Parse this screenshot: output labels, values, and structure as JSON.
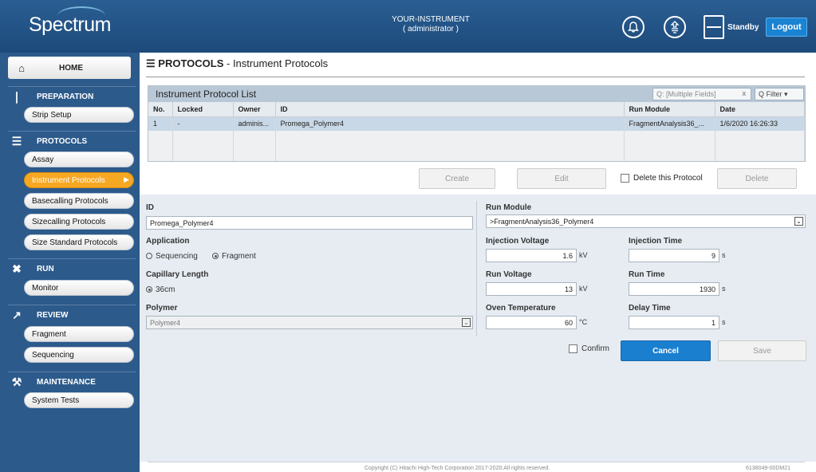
{
  "header": {
    "logo": "Spectrum",
    "instrument": "YOUR-INSTRUMENT",
    "user": "( administrator )",
    "standby": "Standby",
    "logout": "Logout"
  },
  "sidebar": {
    "home": "HOME",
    "preparation": {
      "label": "PREPARATION",
      "items": [
        "Strip Setup"
      ]
    },
    "protocols": {
      "label": "PROTOCOLS",
      "items": [
        "Assay",
        "Instrument Protocols",
        "Basecalling Protocols",
        "Sizecalling Protocols",
        "Size Standard Protocols"
      ]
    },
    "run": {
      "label": "RUN",
      "items": [
        "Monitor"
      ]
    },
    "review": {
      "label": "REVIEW",
      "items": [
        "Fragment",
        "Sequencing"
      ]
    },
    "maintenance": {
      "label": "MAINTENANCE",
      "items": [
        "System Tests"
      ]
    }
  },
  "page": {
    "title": "PROTOCOLS",
    "subtitle": " - Instrument Protocols"
  },
  "list": {
    "title": "Instrument Protocol List",
    "search_placeholder": "Q: [Multiple Fields]",
    "search_clear": "x",
    "filter": "Q  Filter  ▾",
    "columns": [
      "No.",
      "Locked",
      "Owner",
      "ID",
      "Run Module",
      "Date"
    ],
    "rows": [
      [
        "1",
        "-",
        "adminis...",
        "Promega_Polymer4",
        "FragmentAnalysis36_...",
        "1/6/2020 16:26:33"
      ]
    ]
  },
  "actions": {
    "create": "Create",
    "edit": "Edit",
    "delete_check": "Delete this Protocol",
    "delete": "Delete"
  },
  "form": {
    "id_label": "ID",
    "id_value": "Promega_Polymer4",
    "application_label": "Application",
    "app_sequencing": "Sequencing",
    "app_fragment": "Fragment",
    "capillary_label": "Capillary Length",
    "capillary_value": "36cm",
    "polymer_label": "Polymer",
    "polymer_value": "Polymer4",
    "run_module_label": "Run Module",
    "run_module_value": ">FragmentAnalysis36_Polymer4",
    "inj_voltage_label": "Injection Voltage",
    "inj_voltage": "1.6",
    "inj_voltage_unit": "kV",
    "inj_time_label": "Injection Time",
    "inj_time": "9",
    "inj_time_unit": "s",
    "run_voltage_label": "Run Voltage",
    "run_voltage": "13",
    "run_voltage_unit": "kV",
    "run_time_label": "Run Time",
    "run_time": "1930",
    "run_time_unit": "s",
    "oven_label": "Oven Temperature",
    "oven": "60",
    "oven_unit": "°C",
    "delay_label": "Delay Time",
    "delay": "1",
    "delay_unit": "s",
    "confirm": "Confirm",
    "cancel": "Cancel",
    "save": "Save"
  },
  "footer": {
    "copyright": "Copyright  (C)  Hitachi High-Tech Corporation 2017-2020.All rights reserved.",
    "version": "6138049-00DM21"
  }
}
